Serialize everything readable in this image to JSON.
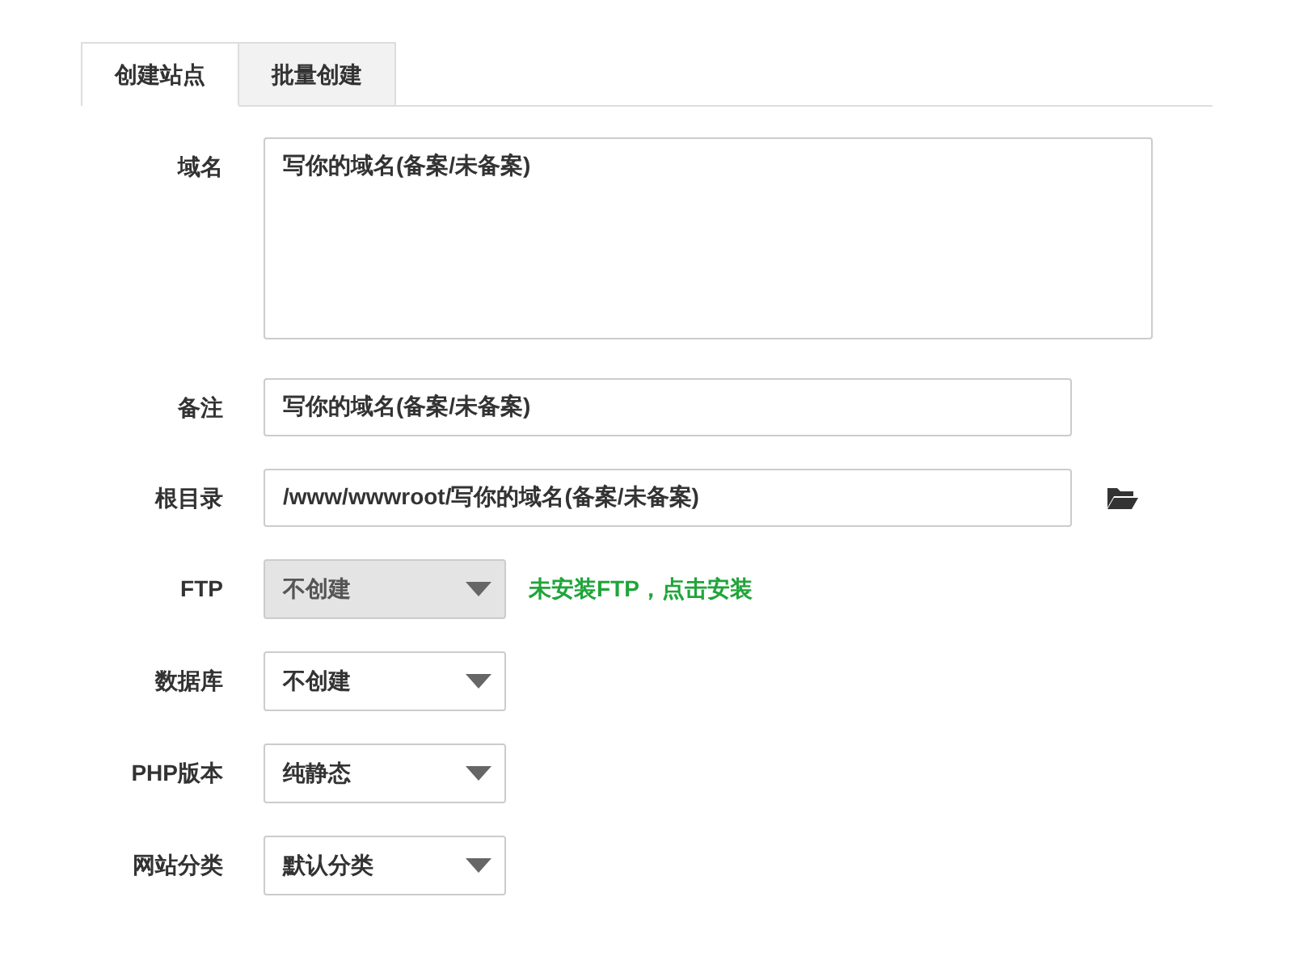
{
  "tabs": [
    {
      "label": "创建站点",
      "selected": true
    },
    {
      "label": "批量创建",
      "selected": false
    }
  ],
  "fields": [
    {
      "kind": "textarea",
      "label": "域名",
      "value": "写你的域名(备案/未备案)"
    },
    {
      "kind": "input",
      "label": "备注",
      "value": "写你的域名(备案/未备案)"
    },
    {
      "kind": "path",
      "label": "根目录",
      "value": "/www/wwwroot/写你的域名(备案/未备案)"
    },
    {
      "kind": "select",
      "label": "FTP",
      "value": "不创建",
      "disabled": true,
      "note": "未安装FTP，点击安装"
    },
    {
      "kind": "select",
      "label": "数据库",
      "value": "不创建",
      "disabled": false
    },
    {
      "kind": "select",
      "label": "PHP版本",
      "value": "纯静态",
      "disabled": false
    },
    {
      "kind": "select",
      "label": "网站分类",
      "value": "默认分类",
      "disabled": false
    }
  ]
}
